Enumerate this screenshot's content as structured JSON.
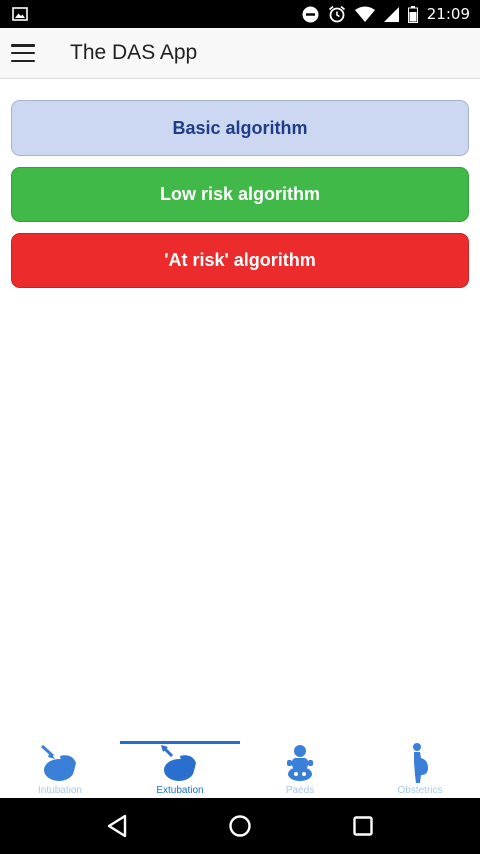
{
  "status_bar": {
    "time": "21:09",
    "icons": [
      "image-icon",
      "do-not-disturb-icon",
      "alarm-icon",
      "wifi-icon",
      "signal-icon",
      "battery-icon"
    ]
  },
  "app_bar": {
    "title": "The DAS App",
    "menu_icon": "menu-icon"
  },
  "algorithms": [
    {
      "label": "Basic algorithm",
      "color": "#ccd8f2",
      "text_color": "#1f3c88"
    },
    {
      "label": "Low risk algorithm",
      "color": "#41b948",
      "text_color": "#ffffff"
    },
    {
      "label": "'At risk' algorithm",
      "color": "#ec2c2c",
      "text_color": "#ffffff"
    }
  ],
  "tabs": [
    {
      "label": "Intubation",
      "icon": "intubation-icon",
      "active": false
    },
    {
      "label": "Extubation",
      "icon": "extubation-icon",
      "active": true
    },
    {
      "label": "Paeds",
      "icon": "paeds-icon",
      "active": false
    },
    {
      "label": "Obstetrics",
      "icon": "obstetrics-icon",
      "active": false
    }
  ],
  "nav_bar": {
    "buttons": [
      "back-icon",
      "home-icon",
      "recents-icon"
    ]
  },
  "colors": {
    "accent": "#1f6fcf",
    "tab_inactive": "#a9c8ee"
  }
}
